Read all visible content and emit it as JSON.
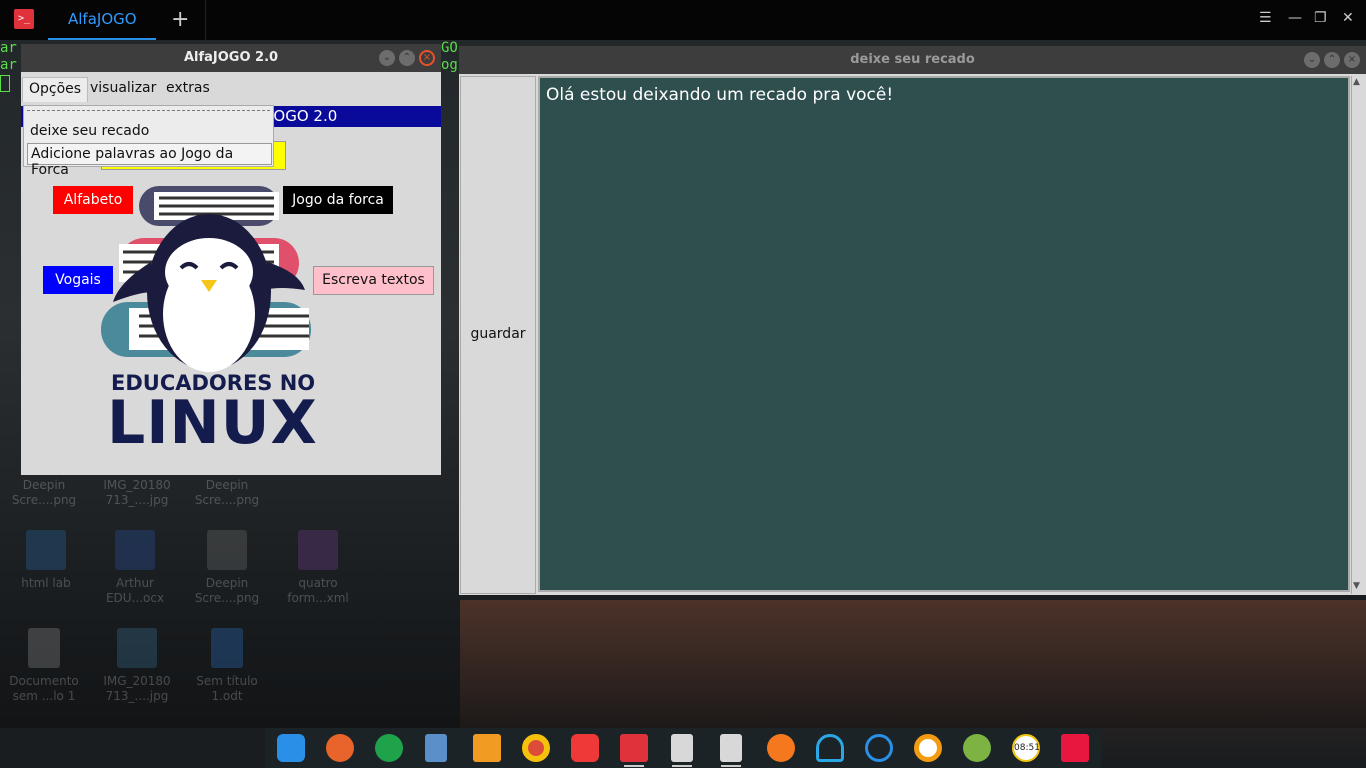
{
  "terminal": {
    "tab_title": "AlfaJOGO",
    "add_tab": "+",
    "logo": ">_",
    "controls": [
      "☰",
      "—",
      "❐",
      "✕"
    ],
    "bg_lines": [
      "ar",
      "ar"
    ],
    "bg_right": [
      "GO",
      "og"
    ]
  },
  "desktop_icons": [
    {
      "label1": "Deepin",
      "label2": "Scre....png"
    },
    {
      "label1": "IMG_20180",
      "label2": "713_....jpg"
    },
    {
      "label1": "Deepin",
      "label2": "Scre....png"
    },
    {
      "label1": "html lab",
      "label2": ""
    },
    {
      "label1": "Arthur",
      "label2": "EDU...ocx"
    },
    {
      "label1": "Deepin",
      "label2": "Scre....png"
    },
    {
      "label1": "quatro",
      "label2": "form...xml"
    },
    {
      "label1": "Documento",
      "label2": "sem ...lo 1"
    },
    {
      "label1": "IMG_20180",
      "label2": "713_....jpg"
    },
    {
      "label1": "Sem título",
      "label2": "1.odt"
    }
  ],
  "win1": {
    "title": "AlfaJOGO 2.0",
    "menu": [
      "Opções",
      "visualizar",
      "extras"
    ],
    "banner": "JOGO 2.0",
    "dropdown": [
      "deixe seu recado",
      "Adicione palavras ao Jogo da Forca"
    ],
    "buttons": {
      "alfabeto": "Alfabeto",
      "forca": "Jogo da forca",
      "vogais": "Vogais",
      "escreva": "Escreva textos"
    },
    "logo_line1": "EDUCADORES NO",
    "logo_line2": "LINUX"
  },
  "win2": {
    "title": "deixe seu recado",
    "save_label": "guardar",
    "text": "Olá estou deixando um recado pra você!"
  },
  "colors": {
    "accent": "#2f9bff",
    "red": "#ff0000",
    "blue": "#0000ff",
    "pink": "#ffc0cb",
    "yellow": "#ffff00",
    "textarea_bg": "#2f4f4f"
  },
  "dock": {
    "items": [
      "launcher-icon",
      "firefox-icon",
      "app-store-icon",
      "file-manager-icon",
      "sublime-text-icon",
      "chrome-icon",
      "vivaldi-icon",
      "terminal-icon",
      "document-viewer-icon",
      "document-viewer-icon",
      "eject-icon",
      "wifi-icon",
      "dropbox-icon",
      "app-icon",
      "power-icon",
      "clock-icon",
      "trash-icon"
    ],
    "clock_text": "08:51"
  }
}
